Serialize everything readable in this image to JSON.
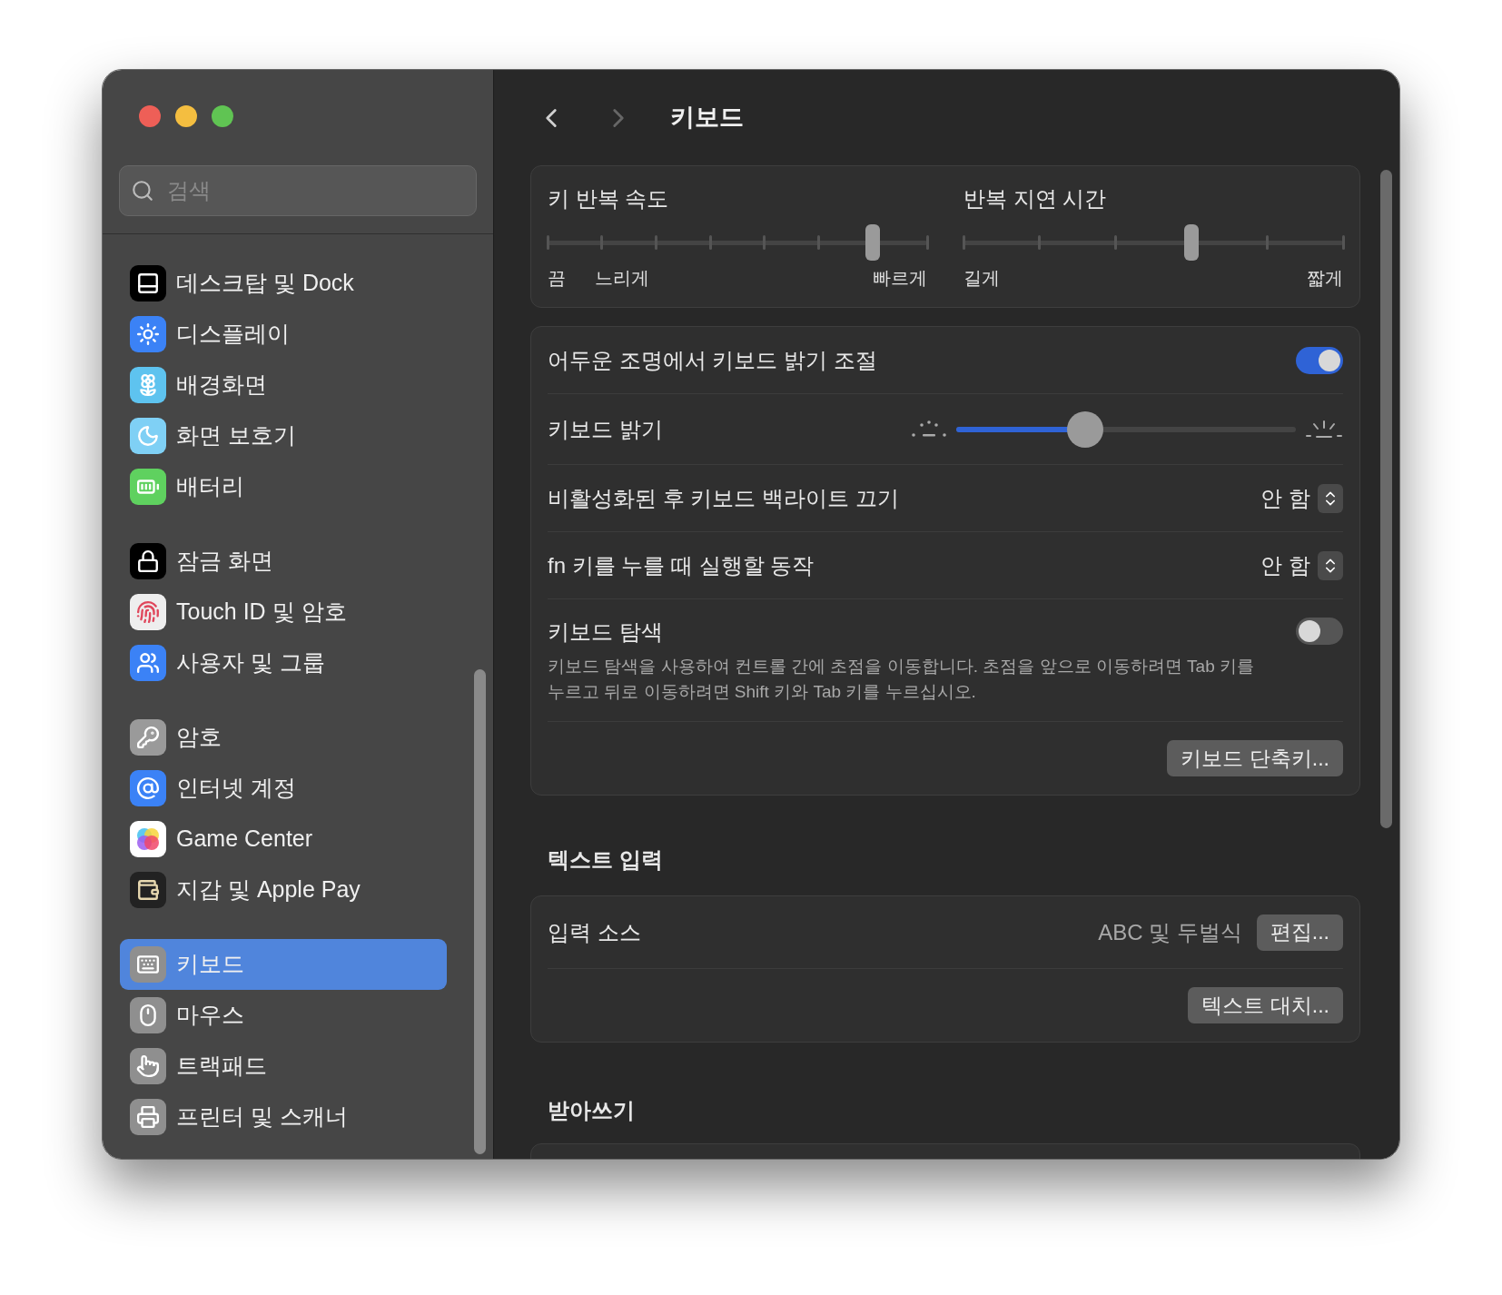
{
  "window": {
    "title": "키보드"
  },
  "sidebar": {
    "search": {
      "placeholder": "검색"
    },
    "groups": [
      [
        {
          "label": "데스크탑 및 Dock",
          "selected": false
        },
        {
          "label": "디스플레이",
          "selected": false
        },
        {
          "label": "배경화면",
          "selected": false
        },
        {
          "label": "화면 보호기",
          "selected": false
        },
        {
          "label": "배터리",
          "selected": false
        }
      ],
      [
        {
          "label": "잠금 화면",
          "selected": false
        },
        {
          "label": "Touch ID 및 암호",
          "selected": false
        },
        {
          "label": "사용자 및 그룹",
          "selected": false
        }
      ],
      [
        {
          "label": "암호",
          "selected": false
        },
        {
          "label": "인터넷 계정",
          "selected": false
        },
        {
          "label": "Game Center",
          "selected": false
        },
        {
          "label": "지갑 및 Apple Pay",
          "selected": false
        }
      ],
      [
        {
          "label": "키보드",
          "selected": true
        },
        {
          "label": "마우스",
          "selected": false
        },
        {
          "label": "트랙패드",
          "selected": false
        },
        {
          "label": "프린터 및 스캐너",
          "selected": false
        }
      ]
    ]
  },
  "repeat_sliders": [
    {
      "title": "키 반복 속도",
      "level": 0.857,
      "labels": [
        {
          "text": "끔",
          "kind": "start"
        },
        {
          "text": "느리게",
          "kind": "second"
        },
        {
          "text": "빠르게",
          "kind": "end"
        }
      ]
    },
    {
      "title": "반복 지연 시간",
      "level": 0.6,
      "labels": [
        {
          "text": "길게",
          "kind": "start"
        },
        {
          "text": "짧게",
          "kind": "end"
        }
      ]
    }
  ],
  "keyboard_rows": [
    {
      "kind": "toggle",
      "label": "어두운 조명에서 키보드 밝기 조절",
      "on": true
    },
    {
      "kind": "slider",
      "label": "키보드 밝기",
      "level": 0.38
    },
    {
      "kind": "popup",
      "label": "비활성화된 후 키보드 백라이트 끄기",
      "value": "안 함"
    },
    {
      "kind": "popup",
      "label": "fn 키를 누를 때 실행할 동작",
      "value": "안 함"
    },
    {
      "kind": "toggle",
      "label": "키보드 탐색",
      "description": "키보드 탐색을 사용하여 컨트롤 간에 초점을 이동합니다. 초점을 앞으로 이동하려면 Tab 키를 누르고 뒤로 이동하려면 Shift 키와 Tab 키를 누르십시오.",
      "on": false
    },
    {
      "kind": "button",
      "button": "키보드 단축키..."
    }
  ],
  "text_input": {
    "title": "텍스트 입력",
    "rows": [
      {
        "kind": "value-button",
        "label": "입력 소스",
        "value": "ABC 및 두벌식",
        "button": "편집..."
      },
      {
        "kind": "button",
        "button": "텍스트 대치..."
      }
    ]
  },
  "dictation": {
    "title": "받아쓰기"
  }
}
